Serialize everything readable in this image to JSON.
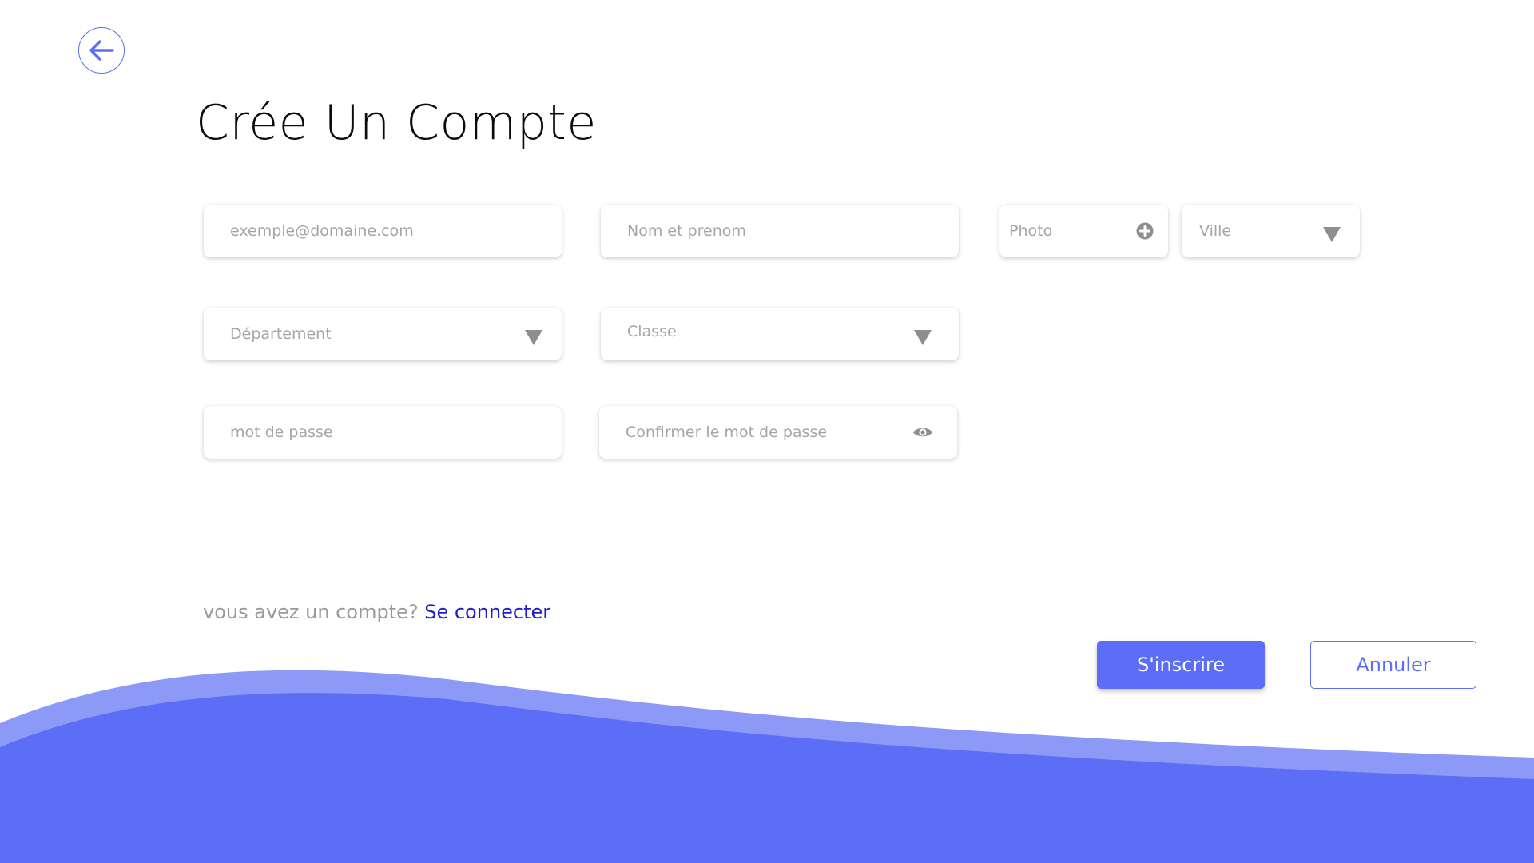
{
  "header": {
    "title": "Crée Un Compte"
  },
  "form": {
    "email_placeholder": "exemple@domaine.com",
    "name_placeholder": "Nom et prenom",
    "photo_placeholder": "Photo",
    "city_placeholder": "Ville",
    "department_placeholder": "Département",
    "class_placeholder": "Classe",
    "password_placeholder": "mot de passe",
    "confirm_password_placeholder": "Confirmer le mot de passe"
  },
  "footer": {
    "question": "vous avez un compte?",
    "login_link": "Se connecter"
  },
  "actions": {
    "submit_label": "S'inscrire",
    "cancel_label": "Annuler"
  },
  "colors": {
    "accent": "#5b6ef5",
    "wave_light": "#8c99f7",
    "link": "#1c1cc9"
  },
  "icons": {
    "back": "arrow-left-icon",
    "photo_add": "plus-circle-icon",
    "dropdown": "caret-down-icon",
    "show_password": "eye-icon"
  }
}
